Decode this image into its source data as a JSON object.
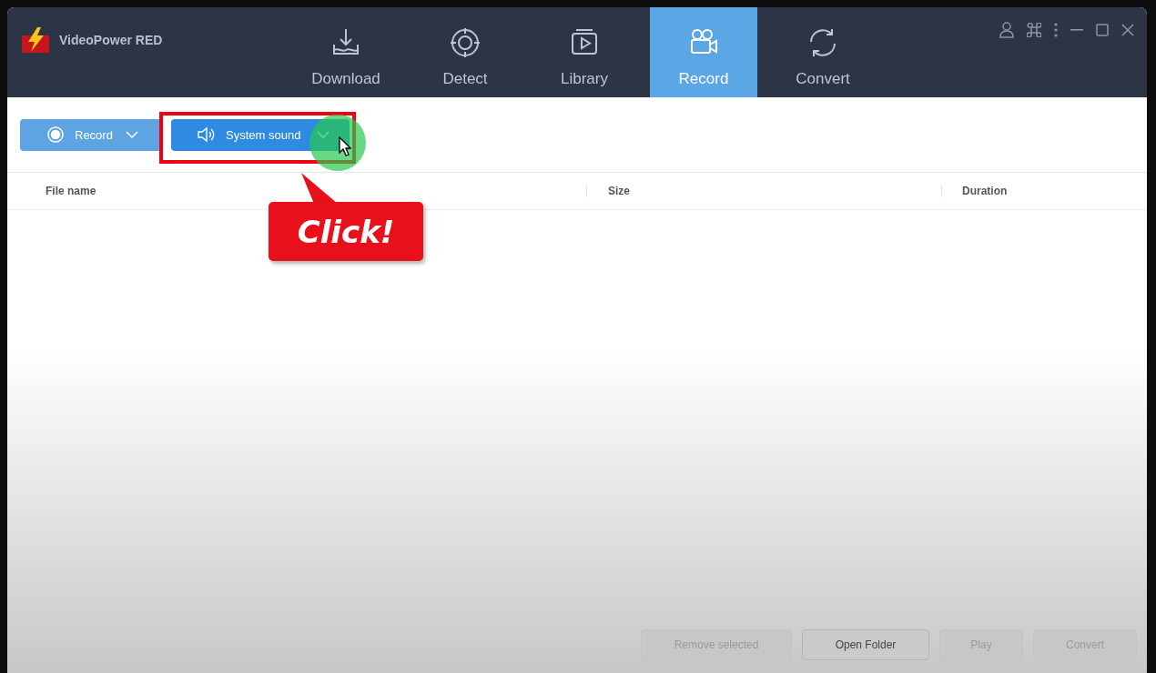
{
  "app": {
    "title": "VideoPower RED"
  },
  "tabs": [
    {
      "label": "Download",
      "selected": false
    },
    {
      "label": "Detect",
      "selected": false
    },
    {
      "label": "Library",
      "selected": false
    },
    {
      "label": "Record",
      "selected": true
    },
    {
      "label": "Convert",
      "selected": false
    }
  ],
  "toolbar": [
    {
      "label": "Record",
      "selected": false
    },
    {
      "label": "System sound",
      "selected": true
    }
  ],
  "table": {
    "columns": [
      "File name",
      "Size",
      "Duration"
    ]
  },
  "actions": [
    {
      "label": "Remove selected",
      "disabled": true
    },
    {
      "label": "Open Folder",
      "disabled": false
    },
    {
      "label": "Play",
      "disabled": true
    },
    {
      "label": "Convert",
      "disabled": true
    }
  ],
  "annotation": {
    "callout": "Click!"
  }
}
